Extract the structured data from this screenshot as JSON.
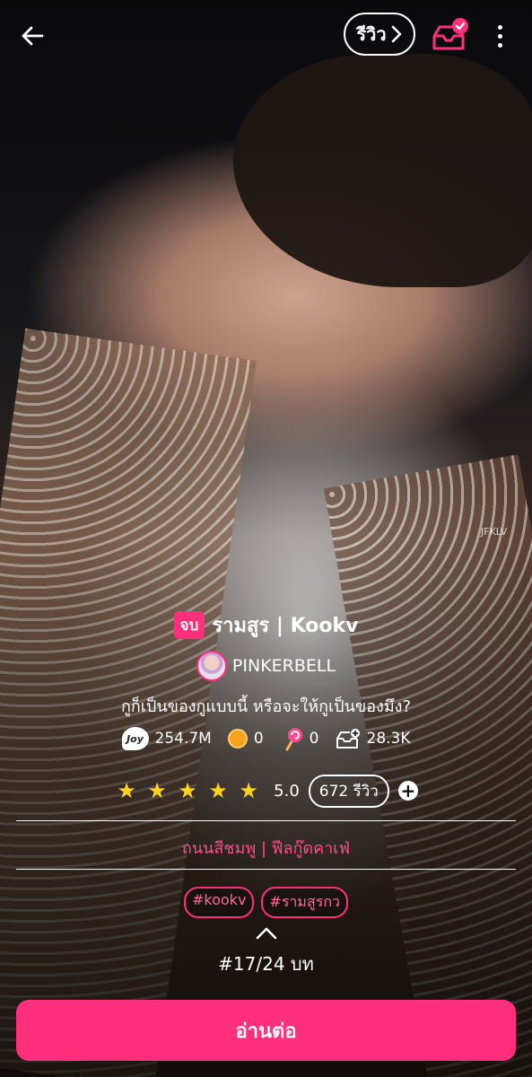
{
  "header": {
    "review_label": "รีวิว"
  },
  "watermark": "JFKLV",
  "story": {
    "status_badge": "จบ",
    "title": "รามสูร | Kookv",
    "author": "PINKERBELL",
    "tagline": "กูก็เป็นของกูแบบนี้ หรือจะให้กูเป็นของมึง?",
    "stats": {
      "views": "254.7M",
      "coins": "0",
      "lollipops": "0",
      "library_adds": "28.3K"
    },
    "rating": {
      "stars_filled": 5,
      "stars_total": 5,
      "value": "5.0",
      "review_count": "672 รีวิว"
    },
    "category": "ถนนสีชมพู | ฟีลกู๊ดคาเฟ่",
    "hashtags": [
      "#kookv",
      "#รามสูรกว"
    ],
    "chapter": "#17/24 บท",
    "continue_label": "อ่านต่อ"
  },
  "colors": {
    "accent": "#ff2f7c",
    "star": "#ffd21f"
  },
  "icons": [
    "back-arrow-icon",
    "chevron-right-icon",
    "library-check-icon",
    "more-vertical-icon",
    "joy-icon",
    "coin-icon",
    "lollipop-icon",
    "library-add-icon",
    "star-icon",
    "plus-icon",
    "chevron-up-icon"
  ]
}
